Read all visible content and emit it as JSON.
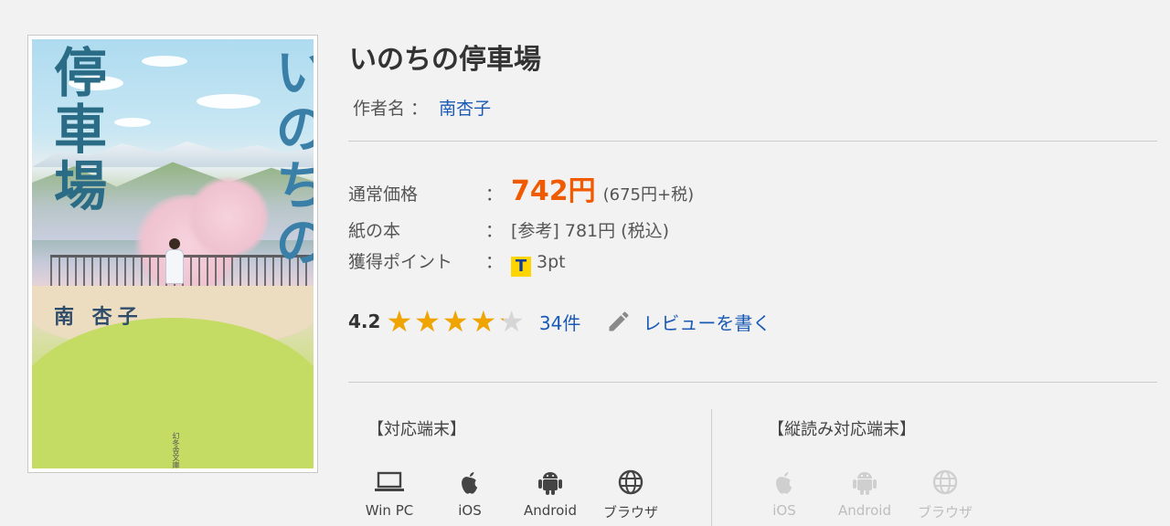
{
  "cover": {
    "title_left": "停車場",
    "title_right": "いのちの",
    "author": "南 杏子",
    "imprint": "幻冬舎文庫"
  },
  "book": {
    "title": "いのちの停車場",
    "author_label": "作者名 ：",
    "author_name": "南杏子"
  },
  "price": {
    "normal_label": "通常価格",
    "colon": "：",
    "normal_value": "742円",
    "normal_tax": "(675円+税)",
    "paper_label": "紙の本",
    "paper_value": "[参考] 781円 (税込)",
    "points_label": "獲得ポイント",
    "points_icon": "T",
    "points_value": "3pt"
  },
  "rating": {
    "score": "4.2",
    "stars_max": 5,
    "stars_value": 4.2,
    "count": "34件",
    "write_review": "レビューを書く"
  },
  "devices": {
    "supported_heading": "【対応端末】",
    "supported": [
      {
        "label": "Win PC",
        "icon": "laptop-icon"
      },
      {
        "label": "iOS",
        "icon": "apple-icon"
      },
      {
        "label": "Android",
        "icon": "android-icon"
      },
      {
        "label": "ブラウザ",
        "icon": "globe-icon"
      }
    ],
    "vertical_heading": "【縦読み対応端末】",
    "vertical": [
      {
        "label": "iOS",
        "icon": "apple-icon"
      },
      {
        "label": "Android",
        "icon": "android-icon"
      },
      {
        "label": "ブラウザ",
        "icon": "globe-icon"
      }
    ]
  },
  "colors": {
    "price": "#f05a00",
    "link": "#1a5ab5",
    "star": "#f0a400",
    "disabled": "#bdbdbd"
  }
}
